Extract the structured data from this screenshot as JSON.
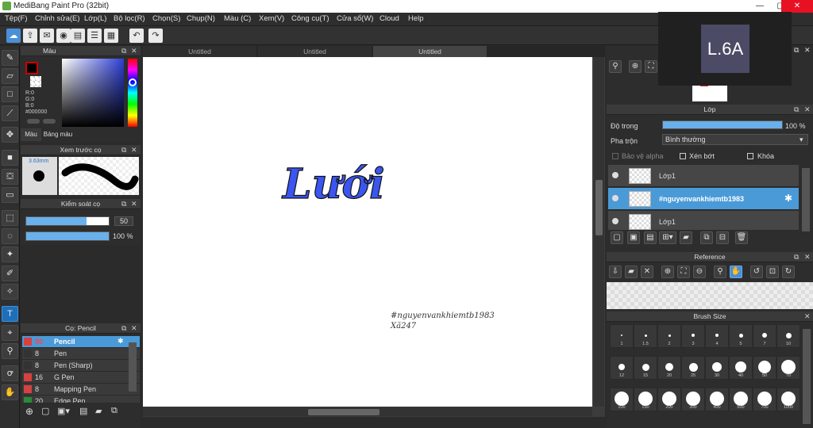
{
  "window": {
    "title": "MediBang Paint Pro (32bit)",
    "controls": [
      "—",
      "▢",
      "✕"
    ]
  },
  "menu": [
    "Tệp(F)",
    "Chỉnh sửa(E)",
    "Lớp(L)",
    "Bộ lọc(R)",
    "Chọn(S)",
    "Chụp(N)",
    "Màu (C)",
    "Xem(V)",
    "Công cụ(T)",
    "Cửa sổ(W)",
    "Cloud",
    "Help"
  ],
  "color_panel": {
    "title": "Màu",
    "r": "R:0",
    "g": "G:0",
    "b": "B:0",
    "hex": "#000000",
    "tab_color": "Màu",
    "tab_palette": "Bảng màu",
    "current": "#000000",
    "accent_ring": "#cc0000"
  },
  "brush_preview": {
    "title": "Xem trước cọ",
    "size": "3.63mm"
  },
  "brush_control": {
    "title": "Kiểm soát cọ",
    "size_value": "50",
    "opacity_value": "100 %",
    "size_fraction": 0.73,
    "opacity_fraction": 1.0
  },
  "brush_list": {
    "title": "Cọ: Pencil",
    "items": [
      {
        "size": "50",
        "name": "Pencil",
        "color": "#d94040",
        "selected": true
      },
      {
        "size": "8",
        "name": "Pen",
        "color": "#333333",
        "selected": false
      },
      {
        "size": "8",
        "name": "Pen (Sharp)",
        "color": "#333333",
        "selected": false
      },
      {
        "size": "16",
        "name": "G Pen",
        "color": "#d94040",
        "selected": false
      },
      {
        "size": "8",
        "name": "Mapping Pen",
        "color": "#d94040",
        "selected": false
      },
      {
        "size": "20",
        "name": "Edge Pen",
        "color": "#2a8a3a",
        "selected": false
      }
    ]
  },
  "doc_tabs": [
    "Untitled",
    "Untitled",
    "Untitled"
  ],
  "canvas": {
    "headline": "Lưới",
    "signature_line1": "#nguyenvankhiemtb1983",
    "signature_line2": "Xã247"
  },
  "layer_panel": {
    "title": "Lớp",
    "opacity_label": "Độ trong",
    "opacity_value": "100 %",
    "opacity_fraction": 1.0,
    "blend_label": "Pha trộn",
    "blend_value": "Bình thường",
    "protect_alpha": "Bảo vệ alpha",
    "clipping": "Xén bớt",
    "lock": "Khóa",
    "layers": [
      {
        "name": "Lớp1",
        "selected": false
      },
      {
        "name": "#nguyenvankhiemtb1983",
        "selected": true
      },
      {
        "name": "Lớp1",
        "selected": false
      }
    ]
  },
  "reference_panel": {
    "title": "Reference"
  },
  "brush_size_panel": {
    "title": "Brush Size",
    "sizes": [
      "1",
      "1.5",
      "2",
      "3",
      "4",
      "5",
      "7",
      "10",
      "12",
      "15",
      "20",
      "25",
      "30",
      "40",
      "50",
      "70",
      "100",
      "150",
      "200",
      "300",
      "400",
      "500",
      "700",
      "1000"
    ]
  },
  "overlay_badge": {
    "text": "L.6A"
  }
}
